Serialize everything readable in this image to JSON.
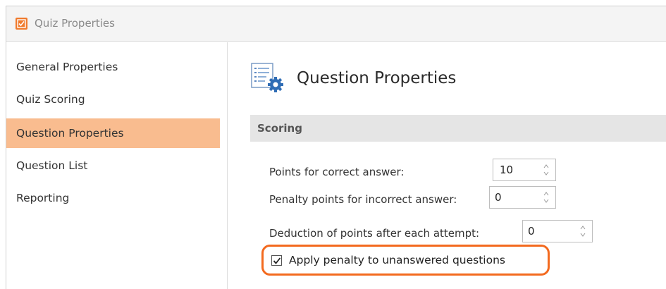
{
  "window": {
    "title": "Quiz Properties"
  },
  "sidebar": {
    "items": [
      {
        "label": "General Properties",
        "active": false
      },
      {
        "label": "Quiz Scoring",
        "active": false
      },
      {
        "label": "Question Properties",
        "active": true
      },
      {
        "label": "Question List",
        "active": false
      },
      {
        "label": "Reporting",
        "active": false
      }
    ]
  },
  "main": {
    "title": "Question Properties",
    "icon": "list-settings-icon",
    "group_header": "Scoring",
    "fields": {
      "points_correct": {
        "label": "Points for correct answer:",
        "value": "10"
      },
      "penalty_incorrect": {
        "label": "Penalty points for incorrect answer:",
        "value": "0"
      },
      "deduction_attempt": {
        "label": "Deduction of points after each attempt:",
        "value": "0"
      }
    },
    "apply_penalty": {
      "label": "Apply penalty to unanswered questions",
      "checked": true
    }
  },
  "colors": {
    "active_nav": "#f9bc8f",
    "highlight_border": "#f36a1f",
    "app_icon": "#f07a2c"
  }
}
